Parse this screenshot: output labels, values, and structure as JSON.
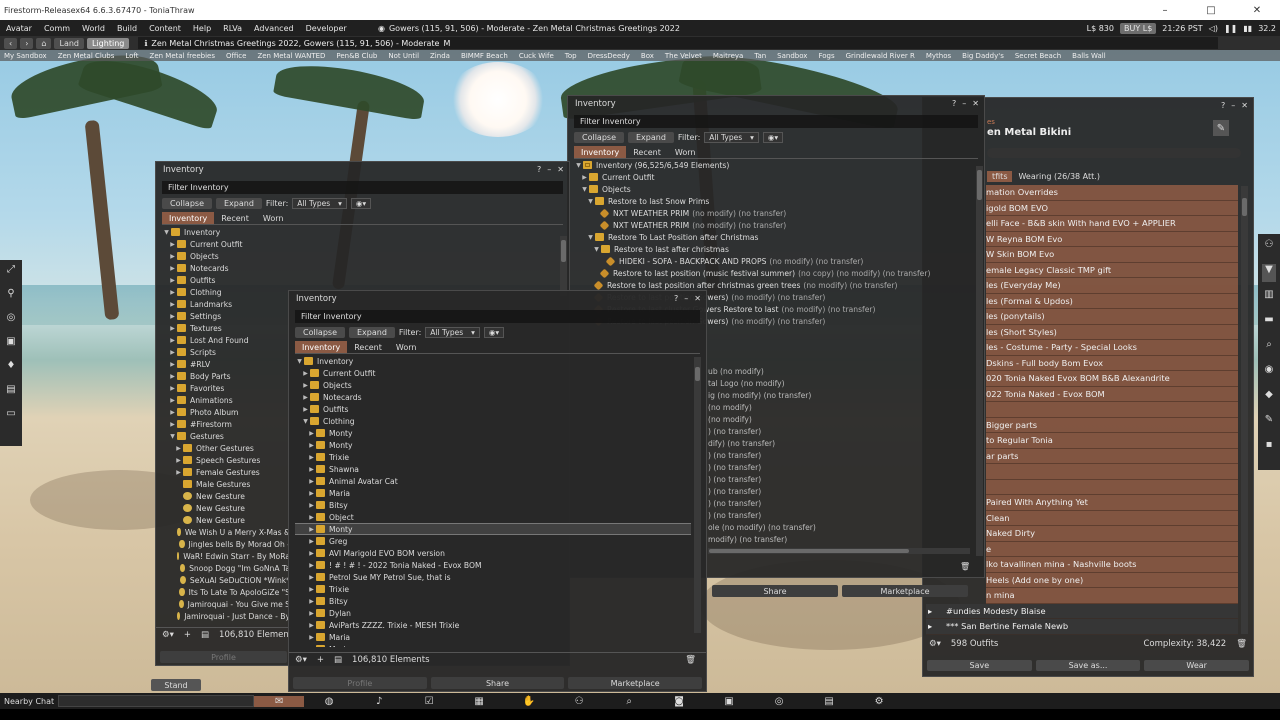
{
  "window": {
    "title": "Firestorm-Releasex64 6.6.3.67470 - ToniaThraw",
    "min": "–",
    "max": "□",
    "close": "✕"
  },
  "menubar": {
    "items": [
      "Avatar",
      "Comm",
      "World",
      "Build",
      "Content",
      "Help",
      "RLVa",
      "Advanced",
      "Developer"
    ],
    "region": "Gowers (115, 91, 506) - Moderate - Zen Metal Christmas Greetings 2022",
    "balance": "L$ 830",
    "buy": "BUY L$",
    "time": "21:26 PST",
    "fps": "32.2"
  },
  "navbar": {
    "land": "Land",
    "lighting": "Lighting",
    "location": "Zen Metal Christmas Greetings 2022, Gowers (115, 91, 506) - Moderate",
    "rating": "M"
  },
  "favorites": [
    "My Sandbox",
    "Zen Metal Clubs",
    "Loft",
    "Zen Metal freebies",
    "Office",
    "Zen Metal WANTED",
    "Pen&B Club",
    "Not Until",
    "Zinda",
    "BIMMF Beach",
    "Cuck Wife",
    "Top",
    "DressDeedy",
    "Box",
    "The Velvet",
    "Maitreya",
    "Tan",
    "Sandbox",
    "Fogs",
    "Grindlewald River R",
    "Mythos",
    "Big Daddy's",
    "Secret Beach",
    "Balls Wall"
  ],
  "inv_common": {
    "title": "Inventory",
    "filter_placeholder": "Filter Inventory",
    "collapse": "Collapse",
    "expand": "Expand",
    "filter_label": "Filter:",
    "all_types": "All Types",
    "tab_inventory": "Inventory",
    "tab_recent": "Recent",
    "tab_worn": "Worn",
    "share": "Share",
    "marketplace": "Marketplace",
    "profile": "Profile"
  },
  "inv_back": {
    "root": "Inventory (96,525/6,549 Elements)",
    "rows": [
      {
        "d": 1,
        "arrow": "▶",
        "icon": "folder",
        "name": "Current Outfit",
        "suffix": ""
      },
      {
        "d": 1,
        "arrow": "▼",
        "icon": "folder",
        "name": "Objects",
        "suffix": ""
      },
      {
        "d": 2,
        "arrow": "▼",
        "icon": "folder",
        "name": "Restore to last Snow Prims",
        "suffix": ""
      },
      {
        "d": 3,
        "arrow": "",
        "icon": "obj",
        "name": "NXT WEATHER PRIM",
        "suffix": "(no modify) (no transfer)"
      },
      {
        "d": 3,
        "arrow": "",
        "icon": "obj",
        "name": "NXT WEATHER PRIM",
        "suffix": "(no modify) (no transfer)"
      },
      {
        "d": 2,
        "arrow": "▼",
        "icon": "folder",
        "name": "Restore To Last Position after Christmas",
        "suffix": ""
      },
      {
        "d": 3,
        "arrow": "▼",
        "icon": "folder",
        "name": "Restore to last after christmas",
        "suffix": ""
      },
      {
        "d": 4,
        "arrow": "",
        "icon": "obj",
        "name": "HIDEKI - SOFA - BACKPACK AND PROPS",
        "suffix": "(no modify) (no transfer)"
      },
      {
        "d": 3,
        "arrow": "",
        "icon": "obj",
        "name": "Restore to last position (music festival summer)",
        "suffix": "(no copy) (no modify) (no transfer)"
      },
      {
        "d": 2,
        "arrow": "",
        "icon": "obj",
        "name": "Restore to last position after christmas green trees",
        "suffix": "(no modify) (no transfer)"
      },
      {
        "d": 2,
        "arrow": "",
        "icon": "obj",
        "name": "Restore to last position Gowers)",
        "suffix": "(no modify) (no transfer)"
      },
      {
        "d": 2,
        "arrow": "",
        "icon": "obj",
        "name": "Restore to last cluster Gowers Restore to last",
        "suffix": "(no modify) (no transfer)"
      },
      {
        "d": 2,
        "arrow": "",
        "icon": "obj",
        "name": "Restore to last position Gowers)",
        "suffix": "(no modify) (no transfer)"
      }
    ],
    "partial": [
      "ub (no modify)",
      "tal Logo (no modify)",
      "ig (no modify) (no transfer)",
      "(no modify)",
      "(no modify)",
      ") (no transfer)",
      "dify) (no transfer)",
      ") (no transfer)",
      ") (no transfer)",
      ") (no transfer)",
      ") (no transfer)",
      ") (no transfer)",
      ") (no transfer)",
      "ole (no modify) (no transfer)",
      "modify) (no transfer)"
    ]
  },
  "inv_left": {
    "count": "106,810 Elemen",
    "rows": [
      {
        "d": 0,
        "arrow": "▼",
        "icon": "folder",
        "name": "Inventory"
      },
      {
        "d": 1,
        "arrow": "▶",
        "icon": "folder",
        "name": "Current Outfit"
      },
      {
        "d": 1,
        "arrow": "▶",
        "icon": "folder",
        "name": "Objects"
      },
      {
        "d": 1,
        "arrow": "▶",
        "icon": "folder",
        "name": "Notecards"
      },
      {
        "d": 1,
        "arrow": "▶",
        "icon": "folder",
        "name": "Outfits"
      },
      {
        "d": 1,
        "arrow": "▶",
        "icon": "folder",
        "name": "Clothing"
      },
      {
        "d": 1,
        "arrow": "▶",
        "icon": "folder",
        "name": "Landmarks"
      },
      {
        "d": 1,
        "arrow": "▶",
        "icon": "folder",
        "name": "Settings"
      },
      {
        "d": 1,
        "arrow": "▶",
        "icon": "folder",
        "name": "Textures"
      },
      {
        "d": 1,
        "arrow": "▶",
        "icon": "folder",
        "name": "Lost And Found"
      },
      {
        "d": 1,
        "arrow": "▶",
        "icon": "folder",
        "name": "Scripts"
      },
      {
        "d": 1,
        "arrow": "▶",
        "icon": "folder",
        "name": "#RLV"
      },
      {
        "d": 1,
        "arrow": "▶",
        "icon": "folder",
        "name": "Body Parts"
      },
      {
        "d": 1,
        "arrow": "▶",
        "icon": "folder",
        "name": "Favorites"
      },
      {
        "d": 1,
        "arrow": "▶",
        "icon": "folder",
        "name": "Animations"
      },
      {
        "d": 1,
        "arrow": "▶",
        "icon": "folder",
        "name": "Photo Album"
      },
      {
        "d": 1,
        "arrow": "▶",
        "icon": "folder",
        "name": "#Firestorm"
      },
      {
        "d": 1,
        "arrow": "▼",
        "icon": "folder",
        "name": "Gestures"
      },
      {
        "d": 2,
        "arrow": "▶",
        "icon": "folder",
        "name": "Other Gestures"
      },
      {
        "d": 2,
        "arrow": "▶",
        "icon": "folder",
        "name": "Speech Gestures"
      },
      {
        "d": 2,
        "arrow": "▶",
        "icon": "folder",
        "name": "Female Gestures"
      },
      {
        "d": 2,
        "arrow": "",
        "icon": "folder",
        "name": "Male Gestures"
      },
      {
        "d": 2,
        "arrow": "",
        "icon": "gest",
        "name": "New Gesture"
      },
      {
        "d": 2,
        "arrow": "",
        "icon": "gest",
        "name": "New Gesture"
      },
      {
        "d": 2,
        "arrow": "",
        "icon": "gest",
        "name": "New Gesture"
      },
      {
        "d": 2,
        "arrow": "",
        "icon": "gest",
        "name": "We Wish U a Merry X-Mas &"
      },
      {
        "d": 2,
        "arrow": "",
        "icon": "gest",
        "name": "Jingles bells By Morad Oh -"
      },
      {
        "d": 2,
        "arrow": "",
        "icon": "gest",
        "name": "WaR! Edwin Starr - By MoRa"
      },
      {
        "d": 2,
        "arrow": "",
        "icon": "gest",
        "name": "Snoop Dogg \"Im GoNnA Ta"
      },
      {
        "d": 2,
        "arrow": "",
        "icon": "gest",
        "name": "SeXuAl SeDuCtiON *Wink*"
      },
      {
        "d": 2,
        "arrow": "",
        "icon": "gest",
        "name": "Its To Late To ApoloGiZe \"S"
      },
      {
        "d": 2,
        "arrow": "",
        "icon": "gest",
        "name": "Jamiroquai - You Give me S"
      },
      {
        "d": 2,
        "arrow": "",
        "icon": "gest",
        "name": "Jamiroquai - Just Dance - By"
      }
    ]
  },
  "inv_front": {
    "count": "106,810 Elements",
    "rows": [
      {
        "d": 0,
        "arrow": "▼",
        "icon": "folder",
        "name": "Inventory"
      },
      {
        "d": 1,
        "arrow": "▶",
        "icon": "folder",
        "name": "Current Outfit"
      },
      {
        "d": 1,
        "arrow": "▶",
        "icon": "folder",
        "name": "Objects"
      },
      {
        "d": 1,
        "arrow": "▶",
        "icon": "folder",
        "name": "Notecards"
      },
      {
        "d": 1,
        "arrow": "▶",
        "icon": "folder",
        "name": "Outfits"
      },
      {
        "d": 1,
        "arrow": "▼",
        "icon": "folder",
        "name": "Clothing"
      },
      {
        "d": 2,
        "arrow": "▶",
        "icon": "folder",
        "name": "Monty"
      },
      {
        "d": 2,
        "arrow": "▶",
        "icon": "folder",
        "name": "Monty"
      },
      {
        "d": 2,
        "arrow": "▶",
        "icon": "folder",
        "name": "Trixie"
      },
      {
        "d": 2,
        "arrow": "▶",
        "icon": "folder",
        "name": "Shawna"
      },
      {
        "d": 2,
        "arrow": "▶",
        "icon": "folder",
        "name": "Animal Avatar Cat"
      },
      {
        "d": 2,
        "arrow": "▶",
        "icon": "folder",
        "name": "Maria"
      },
      {
        "d": 2,
        "arrow": "▶",
        "icon": "folder",
        "name": "Bitsy"
      },
      {
        "d": 2,
        "arrow": "▶",
        "icon": "folder",
        "name": "Object"
      },
      {
        "d": 2,
        "arrow": "▶",
        "icon": "folder",
        "name": "Monty",
        "sel": true
      },
      {
        "d": 2,
        "arrow": "▶",
        "icon": "folder",
        "name": "Greg"
      },
      {
        "d": 2,
        "arrow": "▶",
        "icon": "folder",
        "name": "AVI Marigold EVO BOM version"
      },
      {
        "d": 2,
        "arrow": "▶",
        "icon": "folder",
        "name": "! # ! # ! - 2022 Tonia Naked - Evox BOM"
      },
      {
        "d": 2,
        "arrow": "▶",
        "icon": "folder",
        "name": "Petrol Sue MY Petrol Sue, that is"
      },
      {
        "d": 2,
        "arrow": "▶",
        "icon": "folder",
        "name": "Trixie"
      },
      {
        "d": 2,
        "arrow": "▶",
        "icon": "folder",
        "name": "Bitsy"
      },
      {
        "d": 2,
        "arrow": "▶",
        "icon": "folder",
        "name": "Dylan"
      },
      {
        "d": 2,
        "arrow": "▶",
        "icon": "folder",
        "name": "AviParts ZZZZ. Trixie - MESH Trixie"
      },
      {
        "d": 2,
        "arrow": "▶",
        "icon": "folder",
        "name": "Maria"
      },
      {
        "d": 2,
        "arrow": "▶",
        "icon": "folder",
        "name": "Maria"
      }
    ]
  },
  "appearance": {
    "header_small": "es",
    "outfit_name": "en Metal Bikini",
    "tab_outfits": "tfits",
    "tab_wearing": "Wearing (26/38 Att.)",
    "rows": [
      {
        "name": "mation Overrides",
        "style": "ac"
      },
      {
        "name": "igold BOM EVO",
        "style": "ac"
      },
      {
        "name": "elli Face - B&B skin With hand EVO + APPLIER",
        "style": "ac"
      },
      {
        "name": "W Reyna BOM Evo",
        "style": "ac"
      },
      {
        "name": "W Skin BOM Evo",
        "style": "ac"
      },
      {
        "name": "emale Legacy Classic TMP gift",
        "style": "ac"
      },
      {
        "name": "les (Everyday Me)",
        "style": "ac"
      },
      {
        "name": "les (Formal & Updos)",
        "style": "ac"
      },
      {
        "name": "les (ponytails)",
        "style": "ac"
      },
      {
        "name": "les (Short Styles)",
        "style": "ac"
      },
      {
        "name": "les - Costume - Party - Special Looks",
        "style": "ac"
      },
      {
        "name": "Dskins - Full body Bom Evox",
        "style": "ac"
      },
      {
        "name": "020 Tonia Naked Evox BOM B&B Alexandrite",
        "style": "ac"
      },
      {
        "name": "022 Tonia Naked - Evox BOM",
        "style": "ac"
      },
      {
        "name": "",
        "style": "ac"
      },
      {
        "name": "Bigger parts",
        "style": "ac"
      },
      {
        "name": "to Regular Tonia",
        "style": "ac"
      },
      {
        "name": "ar parts",
        "style": "ac"
      },
      {
        "name": "",
        "style": "ac"
      },
      {
        "name": "",
        "style": "ac"
      },
      {
        "name": "Paired With Anything Yet",
        "style": "ac"
      },
      {
        "name": "Clean",
        "style": "ac"
      },
      {
        "name": "Naked Dirty",
        "style": "ac"
      },
      {
        "name": "e",
        "style": "ac"
      },
      {
        "name": "lko tavallinen mina - Nashville boots",
        "style": "ac"
      },
      {
        "name": "Heels (Add one by one)",
        "style": "ac"
      },
      {
        "name": "n mina",
        "style": "ac"
      },
      {
        "name": "#undies Modesty Blaise",
        "style": "dk"
      },
      {
        "name": "*** San Bertine Female Newb",
        "style": "dk"
      }
    ],
    "outfit_count": "598 Outfits",
    "complexity": "Complexity: 38,422",
    "save": "Save",
    "save_as": "Save as...",
    "wear": "Wear"
  },
  "bottom": {
    "nearby_chat": "Nearby Chat",
    "stand": "Stand"
  }
}
